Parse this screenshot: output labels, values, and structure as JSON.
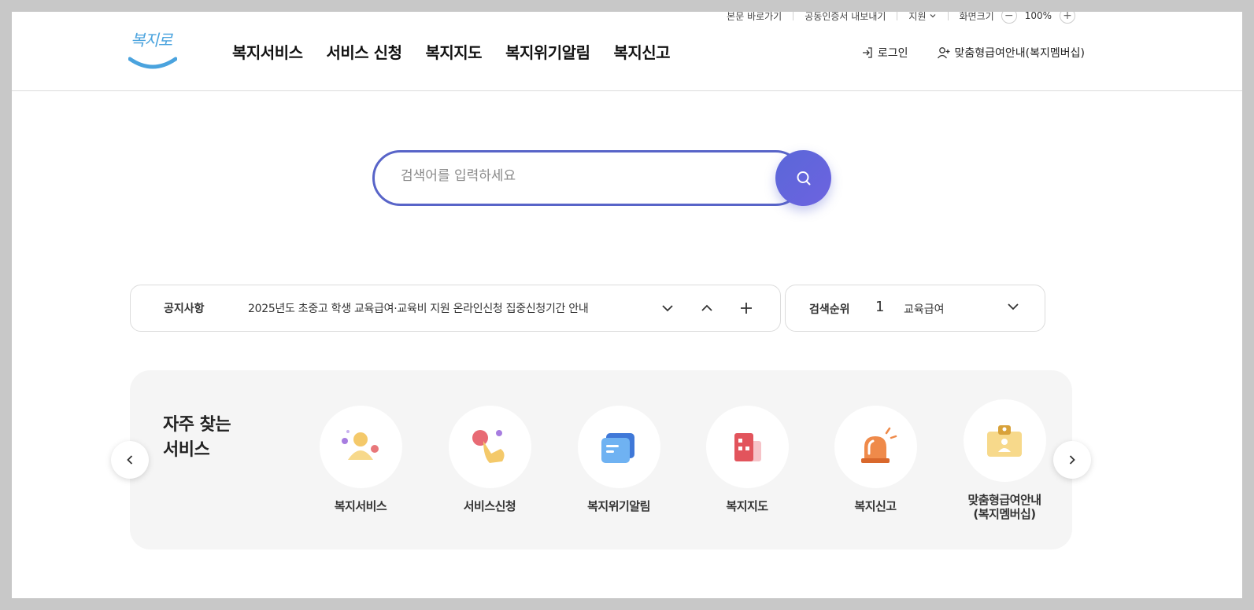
{
  "utility": {
    "skip_to_content": "본문 바로가기",
    "cert_export": "공동인증서 내보내기",
    "language": "지원",
    "zoom_label": "화면크기",
    "zoom_value": "100%",
    "zoom_out": "−",
    "zoom_in": "+"
  },
  "header": {
    "logo_text": "복지로",
    "nav": [
      "복지서비스",
      "서비스 신청",
      "복지지도",
      "복지위기알림",
      "복지신고"
    ],
    "login": "로그인",
    "membership": "맞춤형급여안내(복지멤버십)"
  },
  "search": {
    "placeholder": "검색어를 입력하세요",
    "icon": "search-icon"
  },
  "notice": {
    "title": "공지사항",
    "text": "2025년도 초중고 학생 교육급여·교육비 지원 온라인신청 집중신청기간 안내"
  },
  "ranking": {
    "title": "검색순위",
    "rank": "1",
    "keyword": "교육급여"
  },
  "quick": {
    "title_line1": "자주 찾는",
    "title_line2": "서비스",
    "items": [
      {
        "label": "복지서비스",
        "icon": "people-icon"
      },
      {
        "label": "서비스신청",
        "icon": "hand-pointer-icon"
      },
      {
        "label": "복지위기알림",
        "icon": "document-icon"
      },
      {
        "label": "복지지도",
        "icon": "building-icon"
      },
      {
        "label": "복지신고",
        "icon": "siren-icon"
      },
      {
        "label_line1": "맞춤형급여안내",
        "label_line2": "(복지멤버십)",
        "icon": "id-card-icon"
      }
    ]
  },
  "colors": {
    "accent": "#5864c8",
    "search_button": "#6366dc",
    "logo": "#4aa3de"
  }
}
